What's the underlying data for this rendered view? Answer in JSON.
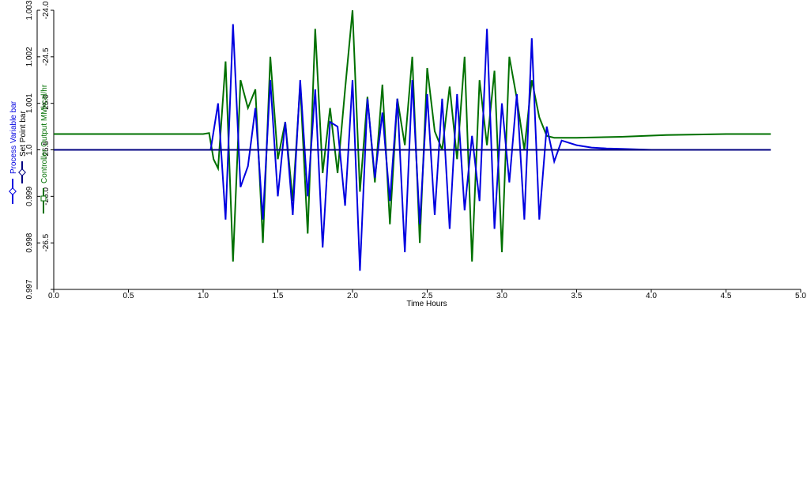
{
  "chart_data": {
    "type": "line",
    "title": "",
    "xlabel": "Time Hours",
    "xlim": [
      0.0,
      5.0
    ],
    "xticks": [
      "0.0",
      "0.5",
      "1.0",
      "1.5",
      "2.0",
      "2.5",
      "3.0",
      "3.5",
      "4.0",
      "4.5",
      "5.0"
    ],
    "y_left": {
      "labels": [
        "Process Variable bar",
        "Set Point bar"
      ],
      "ylim": [
        0.997,
        1.003
      ],
      "ticks": [
        "0.997",
        "0.998",
        "0.999",
        "1.0",
        "1.001",
        "1.002",
        "1.003"
      ]
    },
    "y_right": {
      "label": "Controller Output MMkcal/hr",
      "ylim": [
        -27.0,
        -24.0
      ],
      "ticks": [
        "-26.5",
        "-26.0",
        "-25.5",
        "-25.0",
        "-24.5",
        "-24.0"
      ]
    },
    "series": [
      {
        "name": "Process Variable bar",
        "axis": "left",
        "color": "#0000e0",
        "x": [
          0.0,
          0.25,
          0.5,
          1.0,
          1.05,
          1.1,
          1.15,
          1.2,
          1.25,
          1.3,
          1.35,
          1.4,
          1.45,
          1.5,
          1.55,
          1.6,
          1.65,
          1.7,
          1.75,
          1.8,
          1.85,
          1.9,
          1.95,
          2.0,
          2.05,
          2.1,
          2.15,
          2.2,
          2.25,
          2.3,
          2.35,
          2.4,
          2.45,
          2.5,
          2.55,
          2.6,
          2.65,
          2.7,
          2.75,
          2.8,
          2.85,
          2.9,
          2.95,
          3.0,
          3.05,
          3.1,
          3.15,
          3.2,
          3.25,
          3.3,
          3.35,
          3.4,
          3.5,
          3.6,
          3.7,
          3.8,
          4.0,
          4.1
        ],
        "y": [
          1.0,
          1.0,
          1.0,
          1.0,
          1.0,
          1.001,
          0.9985,
          1.0027,
          0.9992,
          0.99965,
          1.0009,
          0.9985,
          1.0015,
          0.999,
          1.0006,
          0.9986,
          1.0015,
          0.999,
          1.0013,
          0.9979,
          1.0006,
          1.0005,
          0.9988,
          1.0015,
          0.9974,
          1.0011,
          0.9994,
          1.0008,
          0.9989,
          1.0011,
          0.9978,
          1.0015,
          0.9984,
          1.0012,
          0.9986,
          1.0011,
          0.9983,
          1.0012,
          0.9987,
          1.0003,
          0.9989,
          1.0026,
          0.9983,
          1.001,
          0.9993,
          1.0012,
          0.9985,
          1.0024,
          0.9985,
          1.0005,
          0.99975,
          1.0002,
          1.0001,
          1.00005,
          1.00003,
          1.00002,
          1.0,
          1.0
        ]
      },
      {
        "name": "Set Point bar",
        "axis": "left",
        "color": "#000080",
        "x": [
          0.0,
          4.8
        ],
        "y": [
          1.0,
          1.0
        ]
      },
      {
        "name": "Controller Output MMkcal/hr",
        "axis": "right",
        "color": "#007000",
        "x": [
          0.0,
          1.0,
          1.04,
          1.07,
          1.1,
          1.15,
          1.2,
          1.25,
          1.3,
          1.35,
          1.4,
          1.45,
          1.5,
          1.55,
          1.6,
          1.65,
          1.7,
          1.75,
          1.8,
          1.85,
          1.9,
          1.95,
          2.0,
          2.05,
          2.1,
          2.15,
          2.2,
          2.25,
          2.3,
          2.35,
          2.4,
          2.45,
          2.5,
          2.55,
          2.6,
          2.65,
          2.7,
          2.75,
          2.8,
          2.85,
          2.9,
          2.95,
          3.0,
          3.05,
          3.1,
          3.15,
          3.2,
          3.25,
          3.3,
          3.35,
          3.5,
          3.8,
          4.1,
          4.5,
          4.8
        ],
        "y": [
          -25.33,
          -25.33,
          -25.32,
          -25.6,
          -25.7,
          -24.55,
          -26.7,
          -24.75,
          -25.05,
          -24.85,
          -26.5,
          -24.5,
          -25.6,
          -25.2,
          -26.05,
          -24.8,
          -26.4,
          -24.2,
          -25.75,
          -25.05,
          -25.75,
          -24.85,
          -24.0,
          -25.95,
          -24.93,
          -25.85,
          -24.8,
          -26.3,
          -24.95,
          -25.45,
          -24.5,
          -26.5,
          -24.62,
          -25.3,
          -25.5,
          -24.82,
          -25.6,
          -24.5,
          -26.7,
          -24.75,
          -25.45,
          -24.65,
          -26.6,
          -24.5,
          -24.95,
          -25.5,
          -24.75,
          -25.15,
          -25.35,
          -25.37,
          -25.37,
          -25.36,
          -25.34,
          -25.33,
          -25.33
        ]
      }
    ],
    "legend": "left-rotated",
    "grid": false
  }
}
